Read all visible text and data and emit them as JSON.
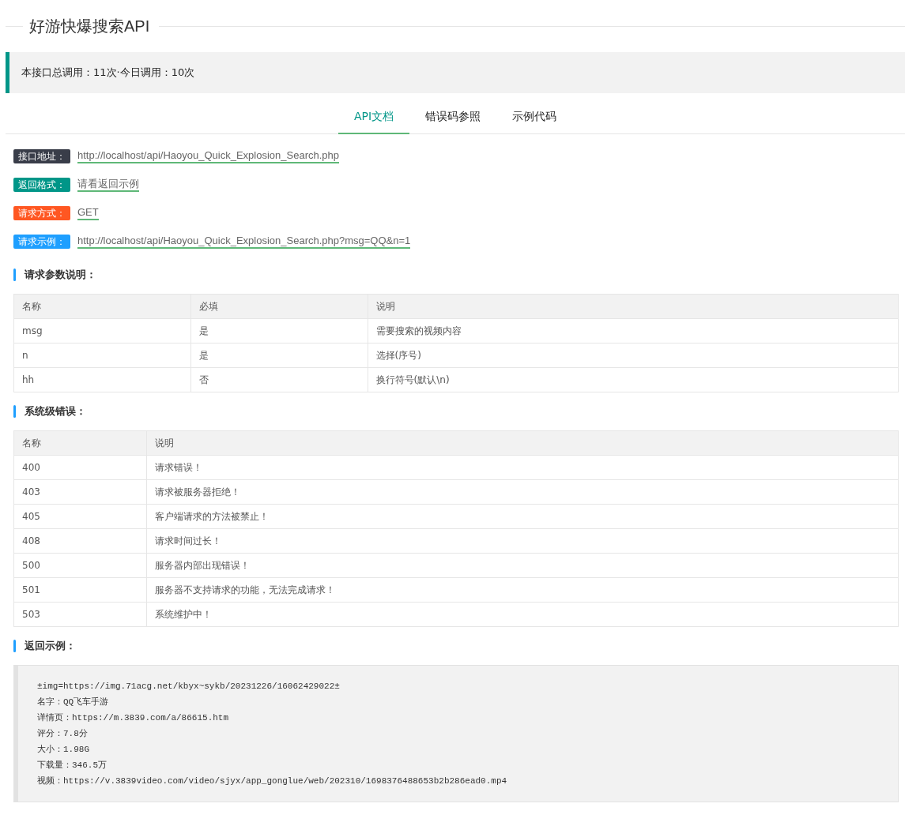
{
  "title": "好游快爆搜索API",
  "stats": "本接口总调用：11次·今日调用：10次",
  "tabs": [
    {
      "label": "API文档",
      "selected": true
    },
    {
      "label": "错误码参照",
      "selected": false
    },
    {
      "label": "示例代码",
      "selected": false
    }
  ],
  "info": [
    {
      "label": "接口地址：",
      "value": "http://localhost/api/Haoyou_Quick_Explosion_Search.php",
      "color": "#393d49"
    },
    {
      "label": "返回格式：",
      "value": "请看返回示例",
      "color": "#009688"
    },
    {
      "label": "请求方式：",
      "value": "GET",
      "color": "#ff5722"
    },
    {
      "label": "请求示例：",
      "value": "http://localhost/api/Haoyou_Quick_Explosion_Search.php?msg=QQ&n=1",
      "color": "#1e9fff"
    }
  ],
  "params": {
    "title": "请求参数说明：",
    "columns": [
      "名称",
      "必填",
      "说明"
    ],
    "rows": [
      [
        "msg",
        "是",
        "需要搜索的视频内容"
      ],
      [
        "n",
        "是",
        "选择(序号)"
      ],
      [
        "hh",
        "否",
        "换行符号(默认\\n)"
      ]
    ]
  },
  "errors": {
    "title": "系统级错误：",
    "columns": [
      "名称",
      "说明"
    ],
    "rows": [
      [
        "400",
        "请求错误！"
      ],
      [
        "403",
        "请求被服务器拒绝！"
      ],
      [
        "405",
        "客户端请求的方法被禁止！"
      ],
      [
        "408",
        "请求时间过长！"
      ],
      [
        "500",
        "服务器内部出现错误！"
      ],
      [
        "501",
        "服务器不支持请求的功能，无法完成请求！"
      ],
      [
        "503",
        "系统维护中！"
      ]
    ]
  },
  "example": {
    "title": "返回示例：",
    "lines": [
      "±img=https://img.71acg.net/kbyx~sykb/20231226/16062429022±",
      "名字：QQ飞车手游",
      "详情页：https://m.3839.com/a/86615.htm",
      "评分：7.8分",
      "大小：1.98G",
      "下载量：346.5万",
      "视频：https://v.3839video.com/video/sjyx/app_gonglue/web/202310/1698376488653b2b286ead0.mp4"
    ]
  }
}
